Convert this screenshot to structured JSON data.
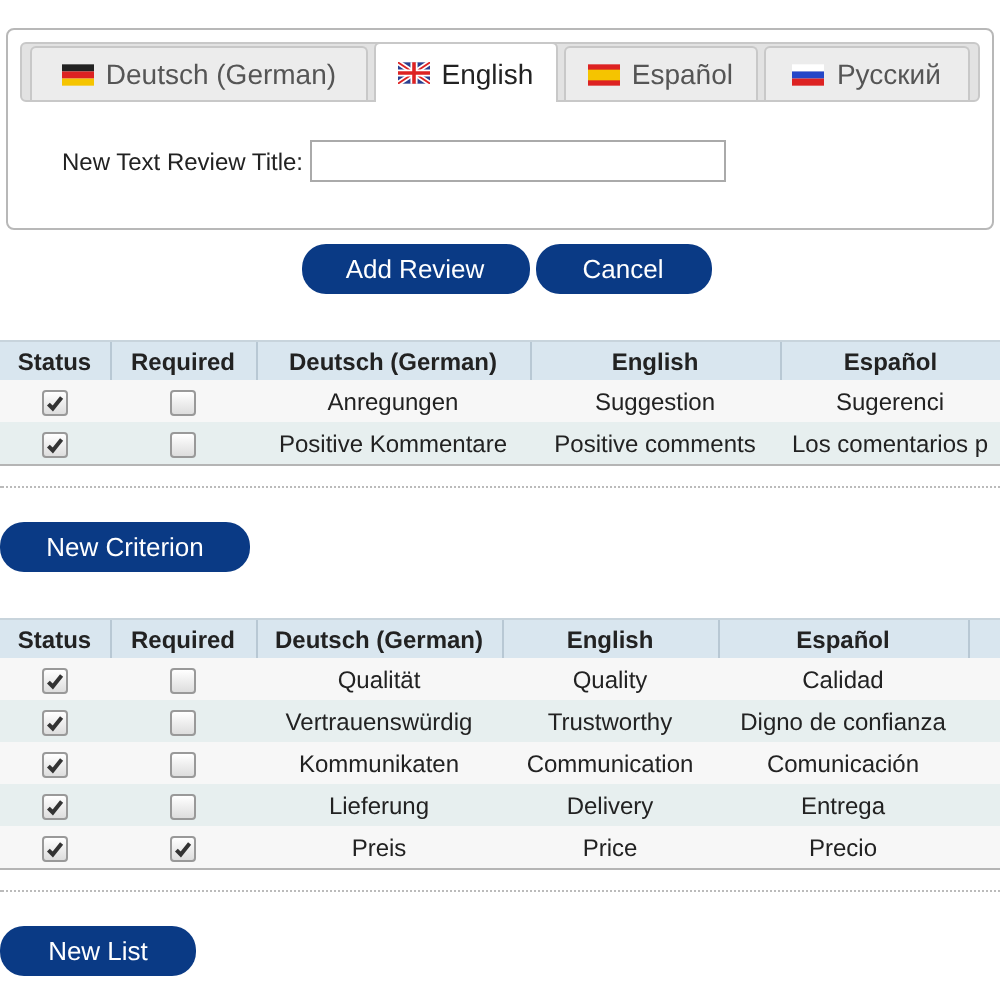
{
  "tabs": [
    {
      "label": "Deutsch (German)",
      "selected": false,
      "kind": "de"
    },
    {
      "label": "English",
      "selected": true,
      "kind": "gb"
    },
    {
      "label": "Español",
      "selected": false,
      "kind": "es"
    },
    {
      "label": "Русский",
      "selected": false,
      "kind": "ru"
    }
  ],
  "form": {
    "label": "New Text Review Title:"
  },
  "buttons": [
    "Add Review",
    "Cancel"
  ],
  "tables": [
    {
      "columns": [
        "Status",
        "Required",
        "Deutsch (German)",
        "English",
        "Español"
      ],
      "rows": [
        {
          "cells": [
            {
              "kind": "checkbox",
              "checked": true
            },
            {
              "kind": "checkbox",
              "checked": false
            },
            "Anregungen",
            "Suggestion",
            "Sugerenci"
          ]
        },
        {
          "cells": [
            {
              "kind": "checkbox",
              "checked": true
            },
            {
              "kind": "checkbox",
              "checked": false
            },
            "Positive Kommentare",
            "Positive comments",
            "Los comentarios p"
          ]
        }
      ],
      "button": "New Criterion"
    },
    {
      "columns": [
        "Status",
        "Required",
        "Deutsch (German)",
        "English",
        "Español"
      ],
      "rows": [
        {
          "cells": [
            {
              "kind": "checkbox",
              "checked": true
            },
            {
              "kind": "checkbox",
              "checked": false
            },
            "Qualität",
            "Quality",
            "Calidad"
          ]
        },
        {
          "cells": [
            {
              "kind": "checkbox",
              "checked": true
            },
            {
              "kind": "checkbox",
              "checked": false
            },
            "Vertrauenswürdig",
            "Trustworthy",
            "Digno de confianza"
          ]
        },
        {
          "cells": [
            {
              "kind": "checkbox",
              "checked": true
            },
            {
              "kind": "checkbox",
              "checked": false
            },
            "Kommunikaten",
            "Communication",
            "Comunicación"
          ]
        },
        {
          "cells": [
            {
              "kind": "checkbox",
              "checked": true
            },
            {
              "kind": "checkbox",
              "checked": false
            },
            "Lieferung",
            "Delivery",
            "Entrega"
          ]
        },
        {
          "cells": [
            {
              "kind": "checkbox",
              "checked": true
            },
            {
              "kind": "checkbox",
              "checked": true
            },
            "Preis",
            "Price",
            "Precio"
          ]
        }
      ],
      "button": "New List"
    }
  ]
}
